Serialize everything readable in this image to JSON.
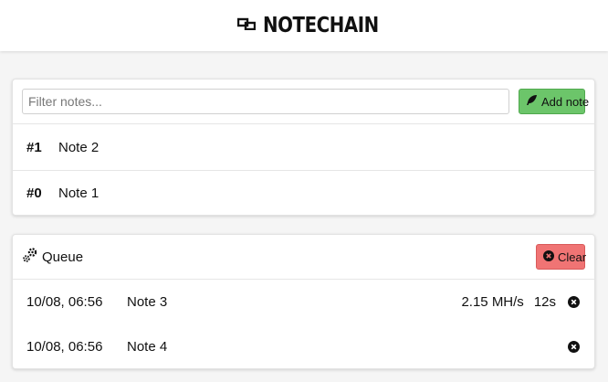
{
  "app": {
    "title": "NOTECHAIN",
    "logo_icon": "chain-link-icon"
  },
  "notes_panel": {
    "filter": {
      "placeholder": "Filter notes...",
      "value": ""
    },
    "add_button": {
      "label": "Add note",
      "icon": "feather-icon",
      "color": "#6cc56a"
    },
    "notes": [
      {
        "number": "#1",
        "title": "Note 2"
      },
      {
        "number": "#0",
        "title": "Note 1"
      }
    ]
  },
  "queue_panel": {
    "title": "Queue",
    "icon": "gears-icon",
    "clear_button": {
      "label": "Clear",
      "icon": "times-circle-icon",
      "color": "#f07474"
    },
    "items": [
      {
        "time": "10/08, 06:56",
        "name": "Note 3",
        "rate": "2.15 MH/s",
        "eta": "12s"
      },
      {
        "time": "10/08, 06:56",
        "name": "Note 4",
        "rate": "",
        "eta": ""
      }
    ]
  }
}
